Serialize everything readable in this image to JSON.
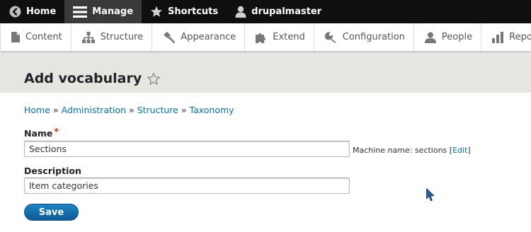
{
  "toolbar": {
    "items": [
      {
        "label": "Home",
        "icon": "back-arrow-circle-icon"
      },
      {
        "label": "Manage",
        "icon": "hamburger-menu-icon"
      },
      {
        "label": "Shortcuts",
        "icon": "star-icon"
      },
      {
        "label": "drupalmaster",
        "icon": "user-icon"
      }
    ],
    "active": "Manage"
  },
  "tray": {
    "items": [
      {
        "label": "Content",
        "icon": "document-icon"
      },
      {
        "label": "Structure",
        "icon": "sitemap-icon"
      },
      {
        "label": "Appearance",
        "icon": "paint-roller-icon"
      },
      {
        "label": "Extend",
        "icon": "puzzle-icon"
      },
      {
        "label": "Configuration",
        "icon": "wrench-icon"
      },
      {
        "label": "People",
        "icon": "people-icon"
      },
      {
        "label": "Reports",
        "icon": "bar-chart-icon"
      }
    ]
  },
  "page": {
    "title": "Add vocabulary",
    "favorite_icon": "star-outline-icon"
  },
  "breadcrumb": {
    "items": [
      "Home",
      "Administration",
      "Structure",
      "Taxonomy"
    ],
    "separator": "»"
  },
  "form": {
    "name": {
      "label": "Name",
      "required_marker": "*",
      "value": "Sections"
    },
    "machine_name": {
      "text": "Machine name: sections",
      "link_open": "[",
      "link": "Edit",
      "link_close": "]"
    },
    "description": {
      "label": "Description",
      "value": "Item categories"
    },
    "save_label": "Save"
  },
  "colors": {
    "toolbar_bg": "#0f0f0f",
    "active_tab_bg": "#3a3a3a",
    "header_bg": "#e6e6e0",
    "link": "#0074bd",
    "primary_button": "#0c5a9a",
    "required": "#e62600"
  }
}
